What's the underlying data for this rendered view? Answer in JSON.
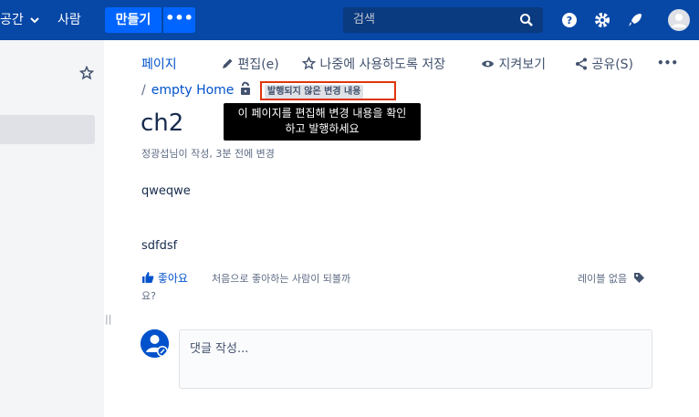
{
  "topbar": {
    "spaces_label": "공간",
    "people_label": "사람",
    "create_label": "만들기",
    "more_label": "•••",
    "search_placeholder": "검색"
  },
  "page_actions": {
    "pages": "페이지",
    "edit": "편집(e)",
    "save_for_later": "나중에 사용하도록 저장",
    "watch": "지켜보기",
    "share": "공유(S)",
    "more": "•••"
  },
  "breadcrumb": {
    "slash": "/",
    "home": "empty Home"
  },
  "status": {
    "unpublished_badge": "발행되지 않은 변경 내용",
    "tooltip_line1": "이 페이지를 편집해 변경 내용을 확인",
    "tooltip_line2": "하고 발행하세요"
  },
  "page": {
    "title": "ch2",
    "byline": "정광섭님이 작성, 3분 전에 변경",
    "paragraphs": [
      "qweqwe",
      "sdfdsf"
    ]
  },
  "footer": {
    "like": "좋아요",
    "like_desc_line1": "처음으로 좋아하는 사람이 되볼까",
    "like_desc_line2": "요?",
    "labels": "레이블 없음"
  },
  "comment": {
    "placeholder": "댓글 작성..."
  },
  "colors": {
    "topbar": "#0747a6",
    "accent": "#0052cc",
    "create": "#0065ff",
    "highlight": "#de350b"
  }
}
